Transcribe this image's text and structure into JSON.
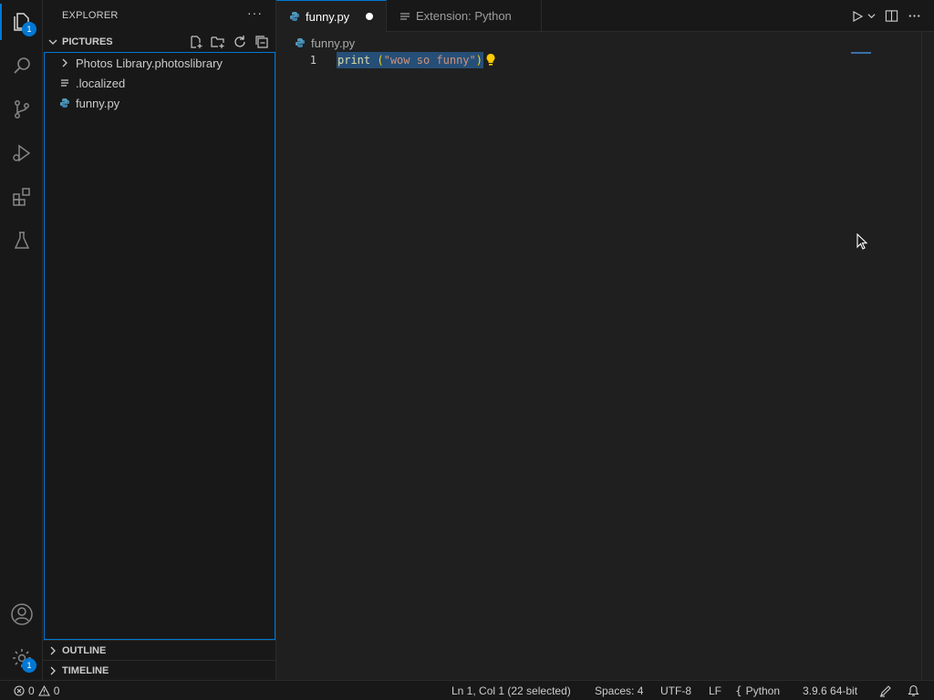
{
  "activity_bar": {
    "explorer_badge": "1",
    "manage_badge": "1"
  },
  "sidebar": {
    "title": "EXPLORER",
    "more": "···",
    "folder": "PICTURES",
    "items": [
      {
        "label": "Photos Library.photoslibrary",
        "icon": "chevron-right-icon"
      },
      {
        "label": ".localized",
        "icon": "file-lines-icon"
      },
      {
        "label": "funny.py",
        "icon": "python-file-icon"
      }
    ],
    "outline": "OUTLINE",
    "timeline": "TIMELINE"
  },
  "tabs": [
    {
      "label": "funny.py",
      "icon": "python-file-icon"
    },
    {
      "label": "Extension: Python",
      "icon": "preview-icon"
    }
  ],
  "breadcrumb": "funny.py",
  "editor": {
    "line_number": "1",
    "tokens": {
      "fn": "print",
      "space": " ",
      "open": "(",
      "string": "\"wow so funny\"",
      "close": ")"
    }
  },
  "status": {
    "errors": "0",
    "warnings": "0",
    "position": "Ln 1, Col 1 (22 selected)",
    "spaces": "Spaces: 4",
    "encoding": "UTF-8",
    "eol": "LF",
    "language": "Python",
    "interpreter": "3.9.6 64-bit"
  },
  "colors": {
    "accent": "#0078d4",
    "selection": "#264f78",
    "python": "#519aba"
  }
}
